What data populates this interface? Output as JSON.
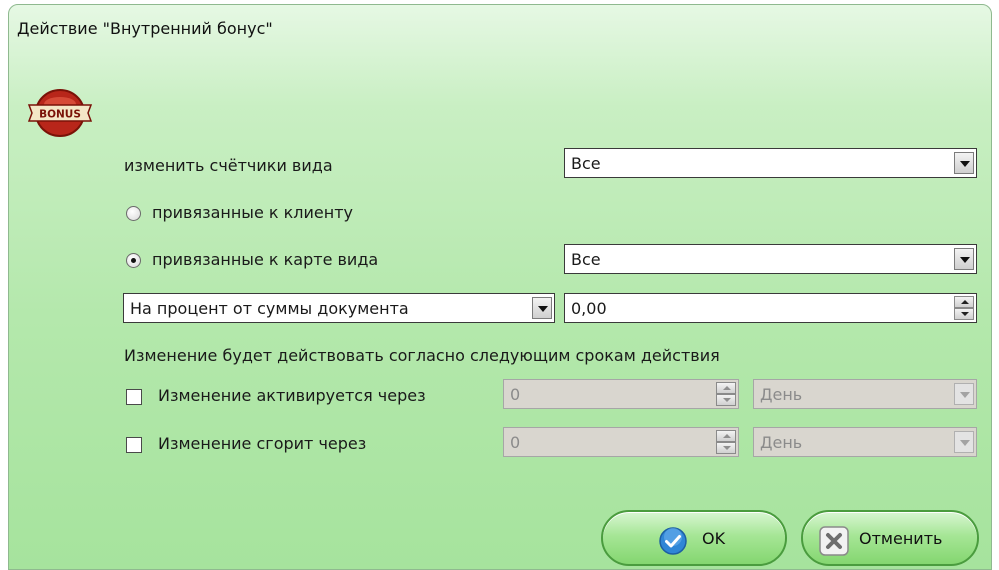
{
  "dialog": {
    "title": "Действие \"Внутренний бонус\"",
    "logo_text": "BONUS"
  },
  "form": {
    "counter_kind_label": "изменить счётчики вида",
    "counter_kind_value": "Все",
    "radio_client_label": "привязанные к клиенту",
    "radio_client_selected": false,
    "radio_card_label": "привязанные к карте вида",
    "radio_card_selected": true,
    "card_kind_value": "Все",
    "change_type_value": "На процент от суммы документа",
    "amount_value": "0,00",
    "terms_label": "Изменение будет действовать согласно следующим срокам действия",
    "activate": {
      "label": "Изменение активируется через",
      "checked": false,
      "value": "0",
      "unit": "День"
    },
    "expire": {
      "label": "Изменение сгорит через",
      "checked": false,
      "value": "0",
      "unit": "День"
    }
  },
  "buttons": {
    "ok_label": "OK",
    "cancel_label": "Отменить"
  },
  "colors": {
    "background_top": "#e6f8e4",
    "background_bottom": "#a6e39d",
    "button_border": "#4a9c3e",
    "ok_icon": "#2f86d6",
    "cancel_icon": "#8a8a8a"
  }
}
